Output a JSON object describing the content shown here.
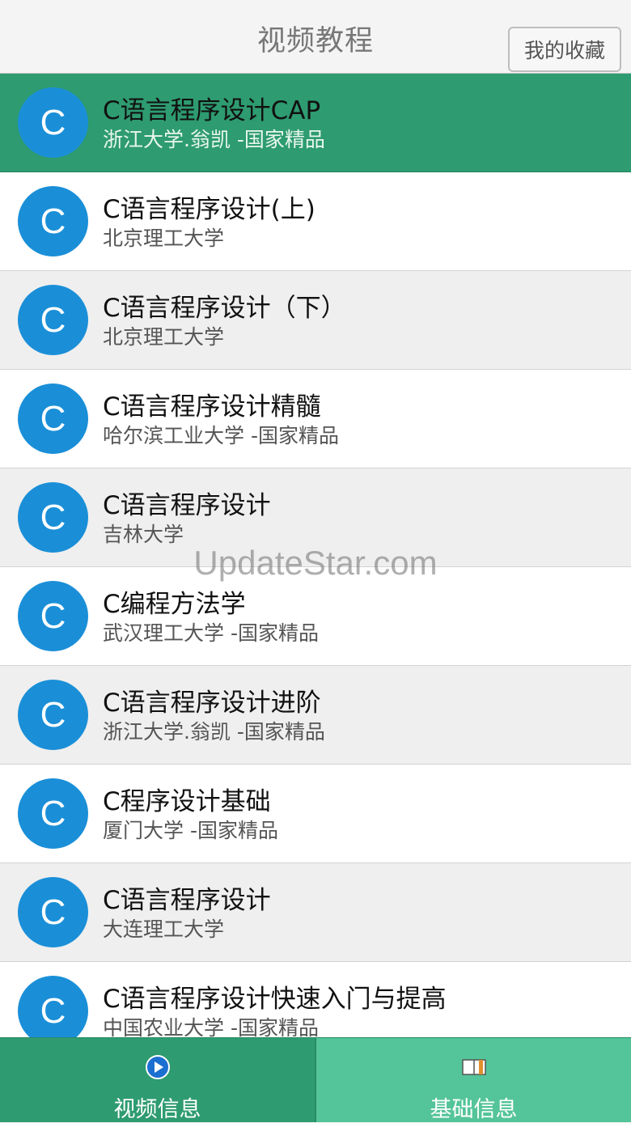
{
  "header": {
    "title": "视频教程",
    "favorites_button": "我的收藏"
  },
  "courses": [
    {
      "avatar": "C",
      "title": "C语言程序设计CAP",
      "subtitle": "浙江大学.翁凯 -国家精品",
      "selected": true
    },
    {
      "avatar": "C",
      "title": "C语言程序设计(上)",
      "subtitle": "北京理工大学"
    },
    {
      "avatar": "C",
      "title": "C语言程序设计（下）",
      "subtitle": "北京理工大学"
    },
    {
      "avatar": "C",
      "title": "C语言程序设计精髓",
      "subtitle": "哈尔滨工业大学 -国家精品"
    },
    {
      "avatar": "C",
      "title": "C语言程序设计",
      "subtitle": "吉林大学"
    },
    {
      "avatar": "C",
      "title": "C编程方法学",
      "subtitle": "武汉理工大学 -国家精品"
    },
    {
      "avatar": "C",
      "title": "C语言程序设计进阶",
      "subtitle": "浙江大学.翁凯 -国家精品"
    },
    {
      "avatar": "C",
      "title": "C程序设计基础",
      "subtitle": "厦门大学 -国家精品"
    },
    {
      "avatar": "C",
      "title": "C语言程序设计",
      "subtitle": "大连理工大学"
    },
    {
      "avatar": "C",
      "title": "C语言程序设计快速入门与提高",
      "subtitle": "中国农业大学 -国家精品"
    }
  ],
  "watermark": "UpdateStar.com",
  "tabs": [
    {
      "label": "视频信息",
      "icon": "play-circle-icon"
    },
    {
      "label": "基础信息",
      "icon": "book-icon"
    }
  ],
  "colors": {
    "accent": "#2e9b71",
    "tab_light": "#54c49a",
    "avatar": "#1a8fd8"
  }
}
